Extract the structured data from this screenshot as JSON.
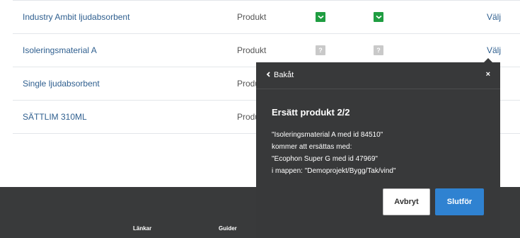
{
  "rows": [
    {
      "name": "Industry Ambit ljudabsorbent",
      "type": "Produkt",
      "status1": "ok",
      "status2": "ok",
      "select": "Välj"
    },
    {
      "name": "Isoleringsmaterial A",
      "type": "Produkt",
      "status1": "unknown",
      "status2": "unknown",
      "select": "Välj"
    },
    {
      "name": "Single ljudabsorbent",
      "type": "Produkt"
    },
    {
      "name": "SÄTTLIM 310ML",
      "type": "Produkt"
    }
  ],
  "icons": {
    "ok": "check-icon",
    "unknown": "question-icon",
    "unknown_glyph": "?"
  },
  "footer": {
    "col1": "Länkar",
    "col2": "Guider"
  },
  "popup": {
    "back_label": "Bakåt",
    "close_glyph": "×",
    "title": "Ersätt produkt 2/2",
    "lines": [
      "\"Isoleringsmaterial A med id 84510\"",
      "kommer att ersättas med:",
      "\"Ecophon Super G med id 47969\"",
      "i mappen: \"Demoprojekt/Bygg/Tak/vind\""
    ],
    "cancel_label": "Avbryt",
    "finish_label": "Slutför"
  },
  "colors": {
    "link": "#2f5f8f",
    "ok": "#1f9d41",
    "unknown": "#c9c9c9",
    "popup_bg": "#38393a",
    "primary": "#2f82d1",
    "footer_bg": "#393a3b"
  }
}
